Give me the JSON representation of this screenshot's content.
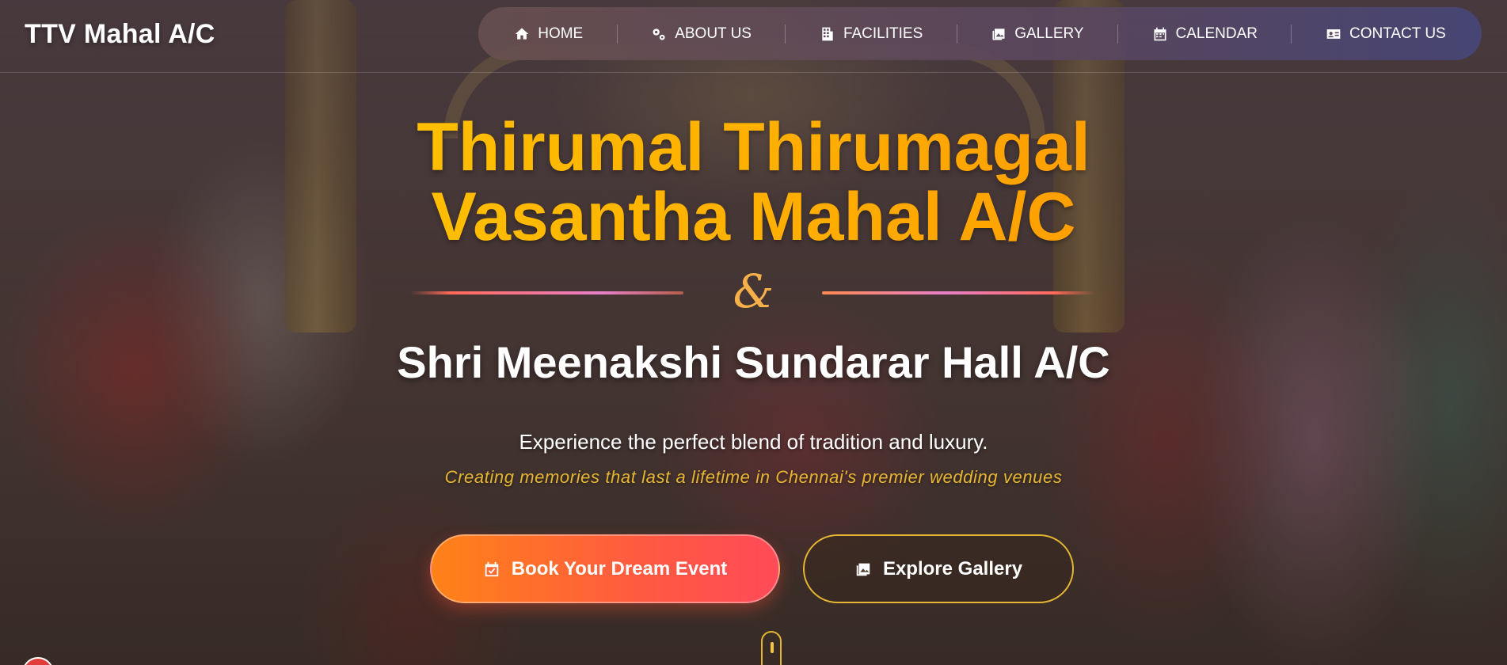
{
  "brand": {
    "name": "TTV Mahal A/C"
  },
  "nav": {
    "items": [
      {
        "label": "HOME",
        "icon": "home-icon"
      },
      {
        "label": "ABOUT US",
        "icon": "gears-icon"
      },
      {
        "label": "FACILITIES",
        "icon": "building-icon"
      },
      {
        "label": "GALLERY",
        "icon": "images-icon"
      },
      {
        "label": "CALENDAR",
        "icon": "calendar-icon"
      },
      {
        "label": "CONTACT US",
        "icon": "contact-card-icon"
      }
    ]
  },
  "hero": {
    "title_line1": "Thirumal Thirumagal",
    "title_line2": "Vasantha Mahal A/C",
    "ampersand": "&",
    "subtitle": "Shri Meenakshi Sundarar Hall A/C",
    "tagline": "Experience the perfect blend of tradition and luxury.",
    "tagline_secondary": "Creating memories that last a lifetime in Chennai's premier wedding venues"
  },
  "cta": {
    "primary_label": "Book Your Dream Event",
    "primary_icon": "calendar-check-icon",
    "secondary_label": "Explore Gallery",
    "secondary_icon": "images-icon"
  },
  "colors": {
    "title_gold": "#ffb000",
    "accent_gold": "#e5b533",
    "primary_button_start": "#ff8218",
    "primary_button_end": "#ff4a58",
    "nav_background": "#5e4a5e"
  }
}
